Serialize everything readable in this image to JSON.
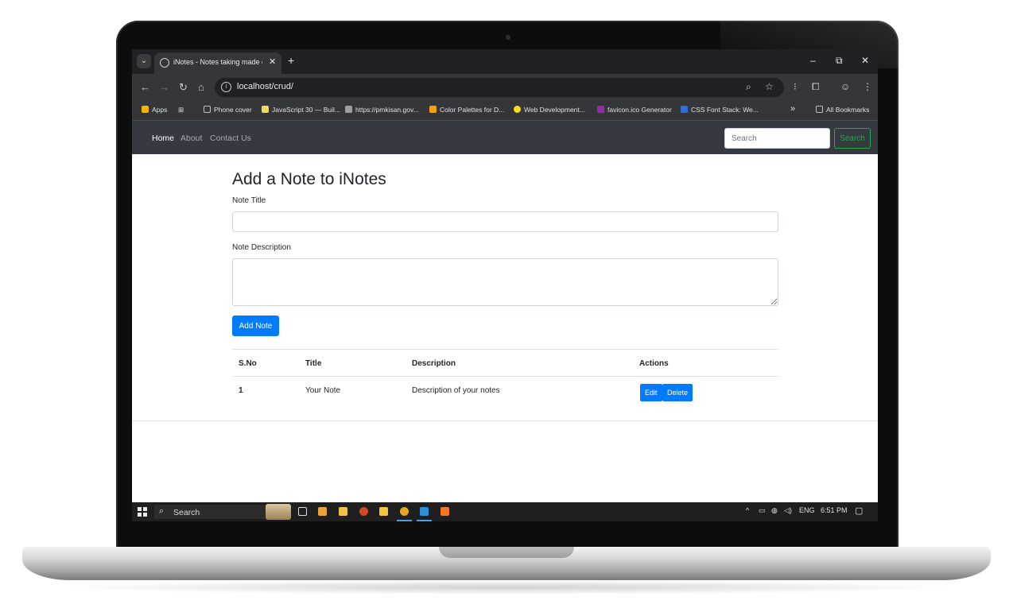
{
  "browser": {
    "tab_title": "iNotes - Notes taking made easy",
    "new_tab_symbol": "+",
    "tab_close_symbol": "✕",
    "url": "localhost/crud/",
    "bookmarks": [
      {
        "label": "Apps",
        "icon": "apps-grid-icon",
        "color": "#f4b400"
      },
      {
        "label": "Phone cover",
        "icon": "folder-icon",
        "color": "#c0c0c0"
      },
      {
        "label": "JavaScript 30 — Buil...",
        "icon": "js30-icon",
        "color": "#f0db4f"
      },
      {
        "label": "https://pmkisan.gov...",
        "icon": "site-icon",
        "color": "#9e9e9e"
      },
      {
        "label": "Color Palettes for D...",
        "icon": "palette-icon",
        "color": "#f4a300"
      },
      {
        "label": "Web Development...",
        "icon": "web-icon",
        "color": "#f7df1e"
      },
      {
        "label": "favicon.ico Generator",
        "icon": "favicon-icon",
        "color": "#9b27af"
      },
      {
        "label": "CSS Font Stack: We...",
        "icon": "css-icon",
        "color": "#2f6fd6"
      }
    ],
    "bookmarks_overflow": "»",
    "all_bookmarks": "All Bookmarks"
  },
  "navbar": {
    "links": [
      "Home",
      "About",
      "Contact Us"
    ],
    "active": "Home",
    "search_placeholder": "Search",
    "search_button": "Search",
    "colors": {
      "bg": "#343a40",
      "search_button": "#28a745"
    }
  },
  "form": {
    "heading": "Add a Note to iNotes",
    "title_label": "Note Title",
    "title_value": "",
    "description_label": "Note Description",
    "description_value": "",
    "submit_label": "Add Note",
    "primary_color": "#007bff"
  },
  "table": {
    "headers": [
      "S.No",
      "Title",
      "Description",
      "Actions"
    ],
    "rows": [
      {
        "sno": "1",
        "title": "Your Note",
        "description": "Description of your notes",
        "edit": "Edit",
        "delete": "Delete"
      }
    ]
  },
  "taskbar": {
    "search_text": "Search",
    "language": "ENG",
    "time": "6:51 PM",
    "tray_icons": [
      "chevron-up-icon",
      "battery-icon",
      "network-icon",
      "volume-icon"
    ]
  }
}
